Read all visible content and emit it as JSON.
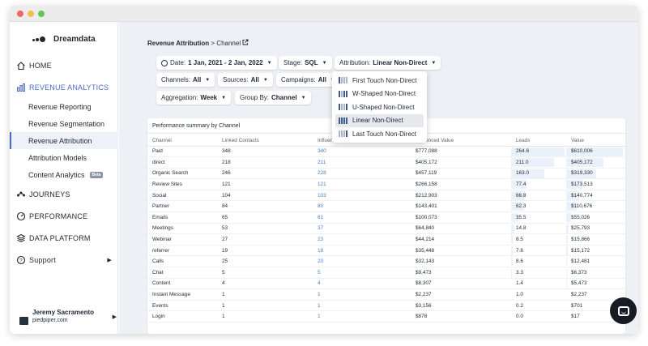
{
  "app": {
    "logo_text": "Dreamdata"
  },
  "sidebar": {
    "items": [
      {
        "label": "HOME",
        "icon": "home-icon"
      },
      {
        "label": "REVENUE ANALYTICS",
        "icon": "revenue-analytics-icon"
      },
      {
        "label": "JOURNEYS",
        "icon": "journeys-icon"
      },
      {
        "label": "PERFORMANCE",
        "icon": "performance-icon"
      },
      {
        "label": "DATA PLATFORM",
        "icon": "data-platform-icon"
      },
      {
        "label": "Support",
        "icon": "help-icon"
      }
    ],
    "sub_items": [
      {
        "label": "Revenue Reporting"
      },
      {
        "label": "Revenue Segmentation"
      },
      {
        "label": "Revenue Attribution"
      },
      {
        "label": "Attribution Models"
      },
      {
        "label": "Content Analytics",
        "badge": "Beta"
      }
    ],
    "user": {
      "name": "Jeremy Sacramento",
      "org": "piedpiper.com"
    }
  },
  "breadcrumb": {
    "parent": "Revenue Attribution",
    "separator": ">",
    "current": "Channel"
  },
  "filters": {
    "date": {
      "label": "Date:",
      "value": "1 Jan, 2021 - 2 Jan, 2022"
    },
    "stage": {
      "label": "Stage:",
      "value": "SQL"
    },
    "attribution": {
      "label": "Attribution:",
      "value": "Linear Non-Direct"
    },
    "channels": {
      "label": "Channels:",
      "value": "All"
    },
    "sources": {
      "label": "Sources:",
      "value": "All"
    },
    "campaigns": {
      "label": "Campaigns:",
      "value": "All"
    },
    "aggregation": {
      "label": "Aggregation:",
      "value": "Week"
    },
    "group_by": {
      "label": "Group By:",
      "value": "Channel"
    }
  },
  "attribution_menu": {
    "options": [
      "First Touch Non-Direct",
      "W-Shaped Non-Direct",
      "U-Shaped Non-Direct",
      "Linear Non-Direct",
      "Last Touch Non-Direct"
    ],
    "selected": "Linear Non-Direct"
  },
  "table": {
    "title": "Performance summary by Channel",
    "columns": [
      "Channel",
      "Linked Contacts",
      "Influenced Contacts",
      "Influenced Value",
      "Leads",
      "Value"
    ],
    "rows": [
      [
        "Paid",
        "348",
        "340",
        "$777,088",
        "264.6",
        "$610,006"
      ],
      [
        "direct",
        "218",
        "211",
        "$405,172",
        "211.0",
        "$405,172"
      ],
      [
        "Organic Search",
        "246",
        "228",
        "$457,119",
        "163.0",
        "$319,330"
      ],
      [
        "Review Sites",
        "121",
        "121",
        "$266,158",
        "77.4",
        "$173,513"
      ],
      [
        "Social",
        "104",
        "103",
        "$212,903",
        "66.8",
        "$140,774"
      ],
      [
        "Partner",
        "84",
        "80",
        "$143,401",
        "62.3",
        "$110,676"
      ],
      [
        "Emails",
        "65",
        "61",
        "$100,073",
        "35.5",
        "$55,026"
      ],
      [
        "Meetings",
        "53",
        "37",
        "$64,840",
        "14.8",
        "$25,793"
      ],
      [
        "Webinar",
        "27",
        "23",
        "$44,214",
        "8.5",
        "$15,866"
      ],
      [
        "referrer",
        "19",
        "18",
        "$35,448",
        "7.6",
        "$15,172"
      ],
      [
        "Calls",
        "25",
        "20",
        "$32,143",
        "8.6",
        "$12,481"
      ],
      [
        "Chat",
        "5",
        "5",
        "$9,473",
        "3.3",
        "$6,373"
      ],
      [
        "Content",
        "4",
        "4",
        "$8,307",
        "1.4",
        "$5,473"
      ],
      [
        "Instant Message",
        "1",
        "1",
        "$2,237",
        "1.0",
        "$2,237"
      ],
      [
        "Events",
        "1",
        "1",
        "$3,156",
        "0.2",
        "$701"
      ],
      [
        "Login",
        "1",
        "1",
        "$878",
        "0.0",
        "$17"
      ]
    ]
  },
  "colors": {
    "accent": "#4a6cc4",
    "link": "#4a7fc0",
    "main_bg": "#edf0f4",
    "bar": "#eaf1fb"
  }
}
